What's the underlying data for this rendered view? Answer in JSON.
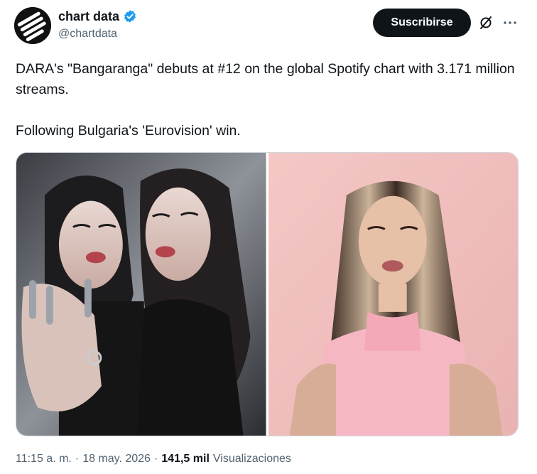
{
  "author": {
    "display_name": "chart data",
    "handle": "@chartdata",
    "verified_icon": "verified-badge-icon",
    "verified_color": "#1d9bf0"
  },
  "actions": {
    "follow_label": "Suscribirse",
    "grok_icon": "grok-icon",
    "more_icon": "more-options-icon"
  },
  "tweet": {
    "text": "DARA's \"Bangaranga\" debuts at #12 on the global Spotify chart with 3.171 million streams.\n\nFollowing Bulgaria's 'Eurovision' win."
  },
  "media": [
    {
      "kind": "photo",
      "alt_icon": "photo-mirror-portrait"
    },
    {
      "kind": "photo",
      "alt_icon": "photo-pink-portrait"
    }
  ],
  "meta": {
    "time": "11:15 a. m.",
    "separator1": "·",
    "date": "18 may. 2026",
    "separator2": "·",
    "views_count": "141,5 mil",
    "views_label": "Visualizaciones"
  },
  "colors": {
    "text_primary": "#0f1419",
    "text_secondary": "#536471",
    "button_bg": "#0f1419",
    "border": "#cfd9de"
  }
}
